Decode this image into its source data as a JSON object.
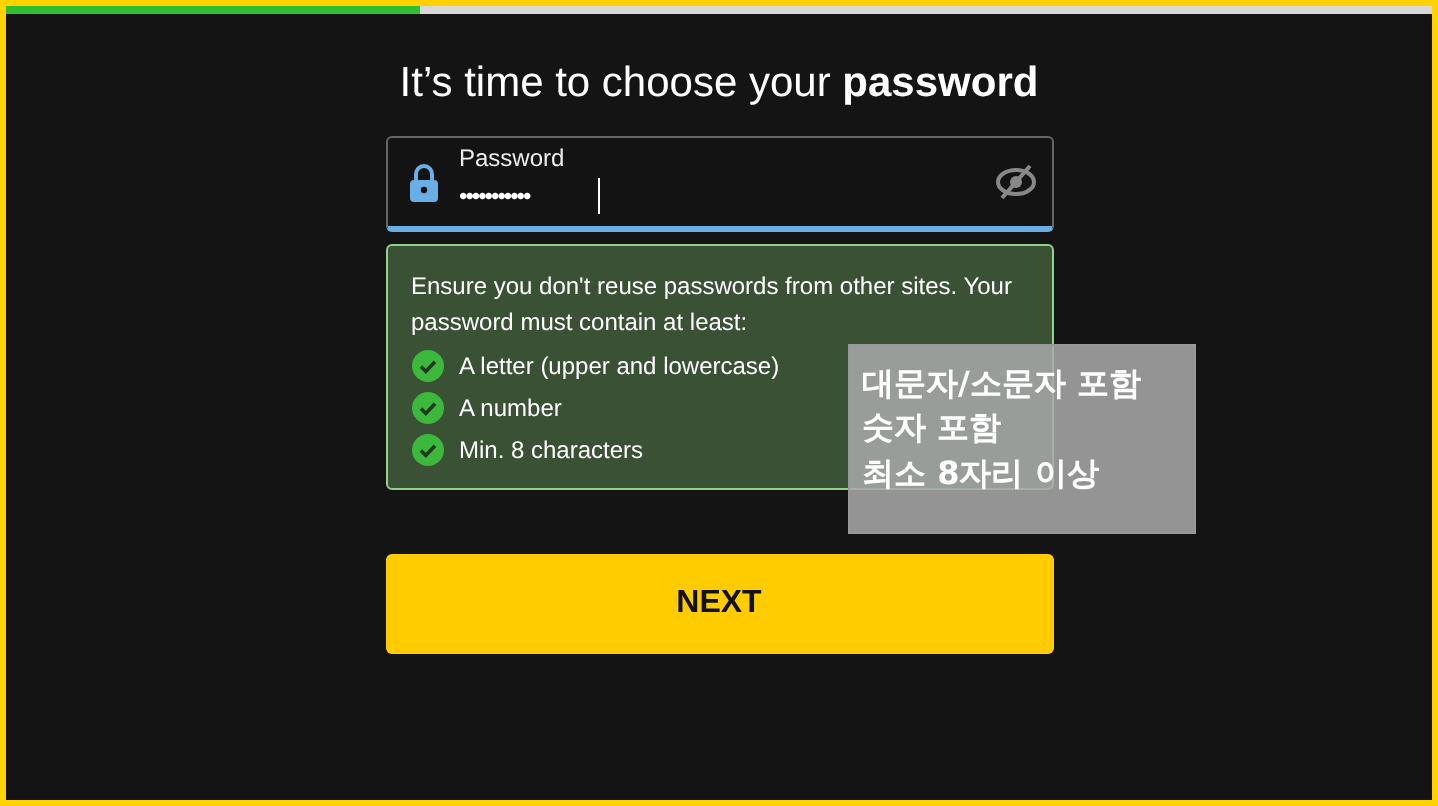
{
  "progress": {
    "level": 0.29
  },
  "title": "It’s time to choose your **password**",
  "password_field": {
    "label": "Password",
    "value": "•••••••••••",
    "focused": true
  },
  "hint": {
    "text": "Ensure you don't reuse passwords from other sites. Your password must contain at least:",
    "requirements": [
      {
        "label": "A letter (upper and lowercase)",
        "met": true
      },
      {
        "label": "A number",
        "met": true
      },
      {
        "label": "Min. 8 characters",
        "met": true
      }
    ]
  },
  "next_button": "NEXT",
  "annotation": {
    "lines": [
      "대문자/소문자 포함",
      "숫자 포함",
      "최소 8자리 이상"
    ]
  }
}
